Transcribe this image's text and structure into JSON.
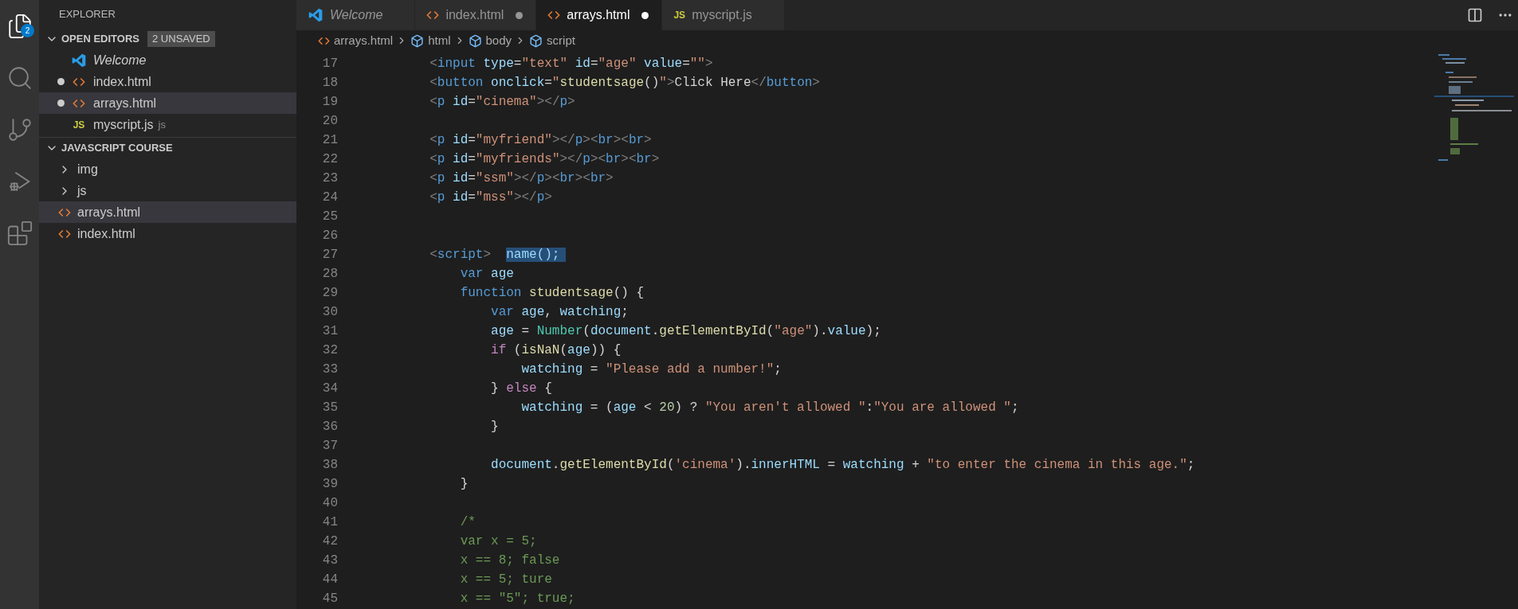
{
  "activity_bar": [
    {
      "kind": "explorer",
      "selected": true,
      "badge": "2"
    },
    {
      "kind": "search",
      "selected": false
    },
    {
      "kind": "source-control",
      "selected": false
    },
    {
      "kind": "debug",
      "selected": false
    },
    {
      "kind": "extensions",
      "selected": false
    }
  ],
  "sidebar": {
    "title": "EXPLORER",
    "open_editors": {
      "title": "OPEN EDITORS",
      "badge": "2 UNSAVED",
      "expanded": true,
      "items": [
        {
          "kind": "vscode",
          "label": "Welcome",
          "preview": true,
          "dirty": false,
          "selected": false
        },
        {
          "kind": "html",
          "label": "index.html",
          "preview": false,
          "dirty": true,
          "selected": false
        },
        {
          "kind": "html",
          "label": "arrays.html",
          "preview": false,
          "dirty": true,
          "selected": true
        },
        {
          "kind": "js",
          "icon_text": "JS",
          "label": "myscript.js",
          "description": "js",
          "preview": false,
          "dirty": false,
          "selected": false
        }
      ]
    },
    "folder": {
      "title": "JAVASCRIPT COURSE",
      "expanded": true,
      "children": [
        {
          "kind": "folder",
          "label": "img",
          "expanded": false,
          "selected": false
        },
        {
          "kind": "folder",
          "label": "js",
          "expanded": false,
          "selected": false
        },
        {
          "kind": "html",
          "label": "arrays.html",
          "selected": true
        },
        {
          "kind": "html",
          "label": "index.html",
          "selected": false
        }
      ]
    }
  },
  "tabs": [
    {
      "kind": "vscode",
      "label": "Welcome",
      "preview": true,
      "dirty": false,
      "selected": false
    },
    {
      "kind": "html",
      "label": "index.html",
      "preview": false,
      "dirty": true,
      "selected": false
    },
    {
      "kind": "html",
      "label": "arrays.html",
      "preview": false,
      "dirty": true,
      "selected": true
    },
    {
      "kind": "js",
      "icon_text": "JS",
      "label": "myscript.js",
      "preview": false,
      "dirty": false,
      "selected": false
    }
  ],
  "breadcrumbs": [
    {
      "kind": "file",
      "label": "arrays.html"
    },
    {
      "kind": "symbol",
      "label": "html"
    },
    {
      "kind": "symbol",
      "label": "body"
    },
    {
      "kind": "symbol",
      "label": "script"
    }
  ],
  "code": [
    {
      "number": "17",
      "tokens": [
        {
          "kind": "tag",
          "text": "            <"
        },
        {
          "kind": "tagname",
          "text": "input"
        },
        {
          "kind": "attr",
          "text": " type"
        },
        {
          "kind": "text",
          "text": "="
        },
        {
          "kind": "str",
          "text": "\"text\""
        },
        {
          "kind": "attr",
          "text": " id"
        },
        {
          "kind": "text",
          "text": "="
        },
        {
          "kind": "str",
          "text": "\"age\""
        },
        {
          "kind": "attr",
          "text": " value"
        },
        {
          "kind": "text",
          "text": "="
        },
        {
          "kind": "str",
          "text": "\"\""
        },
        {
          "kind": "tag",
          "text": ">"
        }
      ]
    },
    {
      "number": "18",
      "tokens": [
        {
          "kind": "tag",
          "text": "            <"
        },
        {
          "kind": "tagname",
          "text": "button"
        },
        {
          "kind": "attr",
          "text": " onclick"
        },
        {
          "kind": "text",
          "text": "="
        },
        {
          "kind": "str",
          "text": "\""
        },
        {
          "kind": "fn",
          "text": "studentsage"
        },
        {
          "kind": "text",
          "text": "()"
        },
        {
          "kind": "str",
          "text": "\""
        },
        {
          "kind": "tag",
          "text": ">"
        },
        {
          "kind": "text",
          "text": "Click Here"
        },
        {
          "kind": "tag",
          "text": "</"
        },
        {
          "kind": "tagname",
          "text": "button"
        },
        {
          "kind": "tag",
          "text": ">"
        }
      ]
    },
    {
      "number": "19",
      "tokens": [
        {
          "kind": "tag",
          "text": "            <"
        },
        {
          "kind": "tagname",
          "text": "p"
        },
        {
          "kind": "attr",
          "text": " id"
        },
        {
          "kind": "text",
          "text": "="
        },
        {
          "kind": "str",
          "text": "\"cinema\""
        },
        {
          "kind": "tag",
          "text": "></"
        },
        {
          "kind": "tagname",
          "text": "p"
        },
        {
          "kind": "tag",
          "text": ">"
        }
      ]
    },
    {
      "number": "20"
    },
    {
      "number": "21",
      "tokens": [
        {
          "kind": "tag",
          "text": "            <"
        },
        {
          "kind": "tagname",
          "text": "p"
        },
        {
          "kind": "attr",
          "text": " id"
        },
        {
          "kind": "text",
          "text": "="
        },
        {
          "kind": "str",
          "text": "\"myfriend\""
        },
        {
          "kind": "tag",
          "text": "></"
        },
        {
          "kind": "tagname",
          "text": "p"
        },
        {
          "kind": "tag",
          "text": "><"
        },
        {
          "kind": "tagname",
          "text": "br"
        },
        {
          "kind": "tag",
          "text": "><"
        },
        {
          "kind": "tagname",
          "text": "br"
        },
        {
          "kind": "tag",
          "text": ">"
        }
      ]
    },
    {
      "number": "22",
      "tokens": [
        {
          "kind": "tag",
          "text": "            <"
        },
        {
          "kind": "tagname",
          "text": "p"
        },
        {
          "kind": "attr",
          "text": " id"
        },
        {
          "kind": "text",
          "text": "="
        },
        {
          "kind": "str",
          "text": "\"myfriends\""
        },
        {
          "kind": "tag",
          "text": "></"
        },
        {
          "kind": "tagname",
          "text": "p"
        },
        {
          "kind": "tag",
          "text": "><"
        },
        {
          "kind": "tagname",
          "text": "br"
        },
        {
          "kind": "tag",
          "text": "><"
        },
        {
          "kind": "tagname",
          "text": "br"
        },
        {
          "kind": "tag",
          "text": ">"
        }
      ]
    },
    {
      "number": "23",
      "tokens": [
        {
          "kind": "tag",
          "text": "            <"
        },
        {
          "kind": "tagname",
          "text": "p"
        },
        {
          "kind": "attr",
          "text": " id"
        },
        {
          "kind": "text",
          "text": "="
        },
        {
          "kind": "str",
          "text": "\"ssm\""
        },
        {
          "kind": "tag",
          "text": "></"
        },
        {
          "kind": "tagname",
          "text": "p"
        },
        {
          "kind": "tag",
          "text": "><"
        },
        {
          "kind": "tagname",
          "text": "br"
        },
        {
          "kind": "tag",
          "text": "><"
        },
        {
          "kind": "tagname",
          "text": "br"
        },
        {
          "kind": "tag",
          "text": ">"
        }
      ]
    },
    {
      "number": "24",
      "tokens": [
        {
          "kind": "tag",
          "text": "            <"
        },
        {
          "kind": "tagname",
          "text": "p"
        },
        {
          "kind": "attr",
          "text": " id"
        },
        {
          "kind": "text",
          "text": "="
        },
        {
          "kind": "str",
          "text": "\"mss\""
        },
        {
          "kind": "tag",
          "text": "></"
        },
        {
          "kind": "tagname",
          "text": "p"
        },
        {
          "kind": "tag",
          "text": ">"
        }
      ]
    },
    {
      "number": "25"
    },
    {
      "number": "26"
    },
    {
      "number": "27",
      "tokens": [
        {
          "kind": "tag",
          "text": "            <"
        },
        {
          "kind": "tagname",
          "text": "script"
        },
        {
          "kind": "tag",
          "text": ">  "
        },
        {
          "kind": "sel",
          "text": "name();"
        }
      ]
    },
    {
      "number": "28",
      "tokens": [
        {
          "kind": "kw",
          "text": "                var"
        },
        {
          "kind": "var",
          "text": " age"
        }
      ]
    },
    {
      "number": "29",
      "tokens": [
        {
          "kind": "kw",
          "text": "                function"
        },
        {
          "kind": "fn",
          "text": " studentsage"
        },
        {
          "kind": "text",
          "text": "() {"
        }
      ]
    },
    {
      "number": "30",
      "tokens": [
        {
          "kind": "kw",
          "text": "                    var"
        },
        {
          "kind": "var",
          "text": " age"
        },
        {
          "kind": "text",
          "text": ", "
        },
        {
          "kind": "var",
          "text": "watching"
        },
        {
          "kind": "text",
          "text": ";"
        }
      ]
    },
    {
      "number": "31",
      "tokens": [
        {
          "kind": "var",
          "text": "                    age"
        },
        {
          "kind": "text",
          "text": " = "
        },
        {
          "kind": "cls",
          "text": "Number"
        },
        {
          "kind": "text",
          "text": "("
        },
        {
          "kind": "var",
          "text": "document"
        },
        {
          "kind": "text",
          "text": "."
        },
        {
          "kind": "fn",
          "text": "getElementById"
        },
        {
          "kind": "text",
          "text": "("
        },
        {
          "kind": "str",
          "text": "\"age\""
        },
        {
          "kind": "text",
          "text": ")."
        },
        {
          "kind": "var",
          "text": "value"
        },
        {
          "kind": "text",
          "text": ");"
        }
      ]
    },
    {
      "number": "32",
      "tokens": [
        {
          "kind": "ctrl",
          "text": "                    if"
        },
        {
          "kind": "text",
          "text": " ("
        },
        {
          "kind": "fn",
          "text": "isNaN"
        },
        {
          "kind": "text",
          "text": "("
        },
        {
          "kind": "var",
          "text": "age"
        },
        {
          "kind": "text",
          "text": ")) {"
        }
      ]
    },
    {
      "number": "33",
      "tokens": [
        {
          "kind": "var",
          "text": "                        watching"
        },
        {
          "kind": "text",
          "text": " = "
        },
        {
          "kind": "str",
          "text": "\"Please add a number!\""
        },
        {
          "kind": "text",
          "text": ";"
        }
      ]
    },
    {
      "number": "34",
      "tokens": [
        {
          "kind": "text",
          "text": "                    } "
        },
        {
          "kind": "ctrl",
          "text": "else"
        },
        {
          "kind": "text",
          "text": " {"
        }
      ]
    },
    {
      "number": "35",
      "tokens": [
        {
          "kind": "var",
          "text": "                        watching"
        },
        {
          "kind": "text",
          "text": " = ("
        },
        {
          "kind": "var",
          "text": "age"
        },
        {
          "kind": "text",
          "text": " < "
        },
        {
          "kind": "num",
          "text": "20"
        },
        {
          "kind": "text",
          "text": ") ? "
        },
        {
          "kind": "str",
          "text": "\"You aren't allowed \""
        },
        {
          "kind": "text",
          "text": ":"
        },
        {
          "kind": "str",
          "text": "\"You are allowed \""
        },
        {
          "kind": "text",
          "text": ";"
        }
      ]
    },
    {
      "number": "36",
      "tokens": [
        {
          "kind": "text",
          "text": "                    }"
        }
      ]
    },
    {
      "number": "37"
    },
    {
      "number": "38",
      "tokens": [
        {
          "kind": "var",
          "text": "                    document"
        },
        {
          "kind": "text",
          "text": "."
        },
        {
          "kind": "fn",
          "text": "getElementById"
        },
        {
          "kind": "text",
          "text": "("
        },
        {
          "kind": "str",
          "text": "'cinema'"
        },
        {
          "kind": "text",
          "text": ")."
        },
        {
          "kind": "var",
          "text": "innerHTML"
        },
        {
          "kind": "text",
          "text": " = "
        },
        {
          "kind": "var",
          "text": "watching"
        },
        {
          "kind": "text",
          "text": " + "
        },
        {
          "kind": "str",
          "text": "\"to enter the cinema in this age.\""
        },
        {
          "kind": "text",
          "text": ";"
        }
      ]
    },
    {
      "number": "39",
      "tokens": [
        {
          "kind": "text",
          "text": "                }"
        }
      ]
    },
    {
      "number": "40"
    },
    {
      "number": "41",
      "tokens": [
        {
          "kind": "comment",
          "text": "                /*"
        }
      ]
    },
    {
      "number": "42",
      "tokens": [
        {
          "kind": "comment",
          "text": "                var x = 5;"
        }
      ]
    },
    {
      "number": "43",
      "tokens": [
        {
          "kind": "comment",
          "text": "                x == 8; false"
        }
      ]
    },
    {
      "number": "44",
      "tokens": [
        {
          "kind": "comment",
          "text": "                x == 5; ture"
        }
      ]
    },
    {
      "number": "45",
      "tokens": [
        {
          "kind": "comment",
          "text": "                x == \"5\"; true;"
        }
      ]
    }
  ]
}
